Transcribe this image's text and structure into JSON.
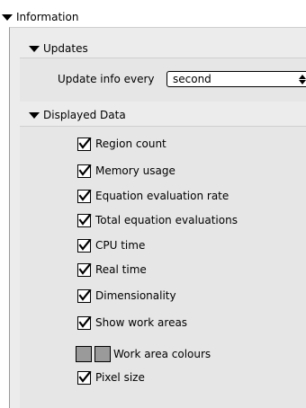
{
  "sections": {
    "information": "Information",
    "updates": "Updates",
    "displayed_data": "Displayed Data"
  },
  "update_info": {
    "label": "Update info every",
    "selected": "second"
  },
  "displayed_items": [
    {
      "label": "Region count",
      "checked": true
    },
    {
      "label": "Memory usage",
      "checked": true
    },
    {
      "label": "Equation evaluation rate",
      "checked": true
    },
    {
      "label": "Total equation evaluations",
      "checked": true
    },
    {
      "label": "CPU time",
      "checked": true
    },
    {
      "label": "Real time",
      "checked": true
    },
    {
      "label": "Dimensionality",
      "checked": true
    },
    {
      "label": "Show work areas",
      "checked": true
    }
  ],
  "work_area_colours": {
    "label": "Work area colours"
  },
  "pixel_size": {
    "label": "Pixel size",
    "checked": true
  }
}
